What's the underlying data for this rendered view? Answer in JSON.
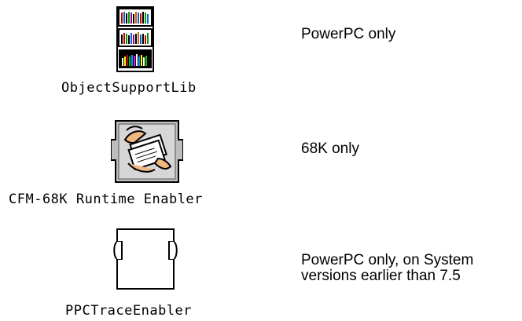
{
  "files": [
    {
      "icon": "library-books-icon",
      "name": "ObjectSupportLib",
      "note_lines": [
        "PowerPC only"
      ]
    },
    {
      "icon": "cfm-enabler-hand-icon",
      "name": "CFM-68K Runtime Enabler",
      "note_lines": [
        "68K only"
      ]
    },
    {
      "icon": "extension-puzzle-icon",
      "name": "PPCTraceEnabler",
      "note_lines": [
        "PowerPC only, on System",
        "versions earlier than 7.5"
      ]
    }
  ]
}
